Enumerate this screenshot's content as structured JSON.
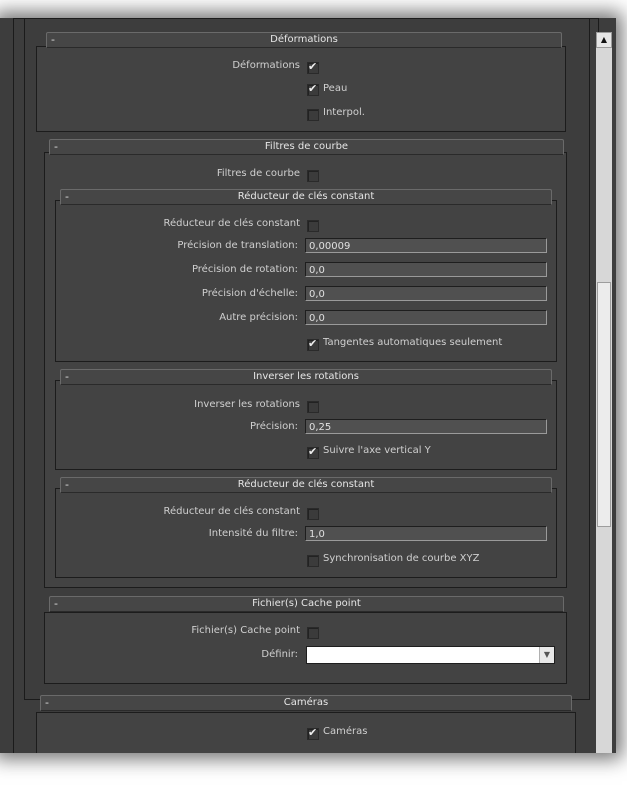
{
  "deformations": {
    "title": "Déformations",
    "checkbox_label": "Déformations",
    "checked": true,
    "peau": {
      "label": "Peau",
      "checked": true
    },
    "interpol": {
      "label": "Interpol.",
      "checked": false
    }
  },
  "filtres": {
    "title": "Filtres de courbe",
    "checkbox_label": "Filtres de courbe",
    "checked": false,
    "reducteur1": {
      "title": "Réducteur de clés constant",
      "checkbox_label": "Réducteur de clés constant",
      "checked": false,
      "translation_label": "Précision de translation:",
      "translation_value": "0,00009",
      "rotation_label": "Précision de rotation:",
      "rotation_value": "0,0",
      "echelle_label": "Précision d'échelle:",
      "echelle_value": "0,0",
      "autre_label": "Autre précision:",
      "autre_value": "0,0",
      "tangentes_label": "Tangentes automatiques seulement",
      "tangentes_checked": true
    },
    "inverser": {
      "title": "Inverser les rotations",
      "checkbox_label": "Inverser les rotations",
      "checked": false,
      "precision_label": "Précision:",
      "precision_value": "0,25",
      "suivre_label": "Suivre l'axe vertical Y",
      "suivre_checked": true
    },
    "reducteur2": {
      "title": "Réducteur de clés constant",
      "checkbox_label": "Réducteur de clés constant",
      "checked": false,
      "intensite_label": "Intensité du filtre:",
      "intensite_value": "1,0",
      "sync_label": "Synchronisation de courbe XYZ",
      "sync_checked": false
    }
  },
  "cache": {
    "title": "Fichier(s) Cache point",
    "checkbox_label": "Fichier(s) Cache point",
    "checked": false,
    "definir_label": "Définir:",
    "definir_value": ""
  },
  "cameras": {
    "title": "Caméras",
    "checkbox_label": "Caméras",
    "checked": true
  },
  "ui": {
    "minus": "-",
    "tick": "✔",
    "dropdown_arrow": "▼",
    "scroll_up_arrow": "▲"
  }
}
